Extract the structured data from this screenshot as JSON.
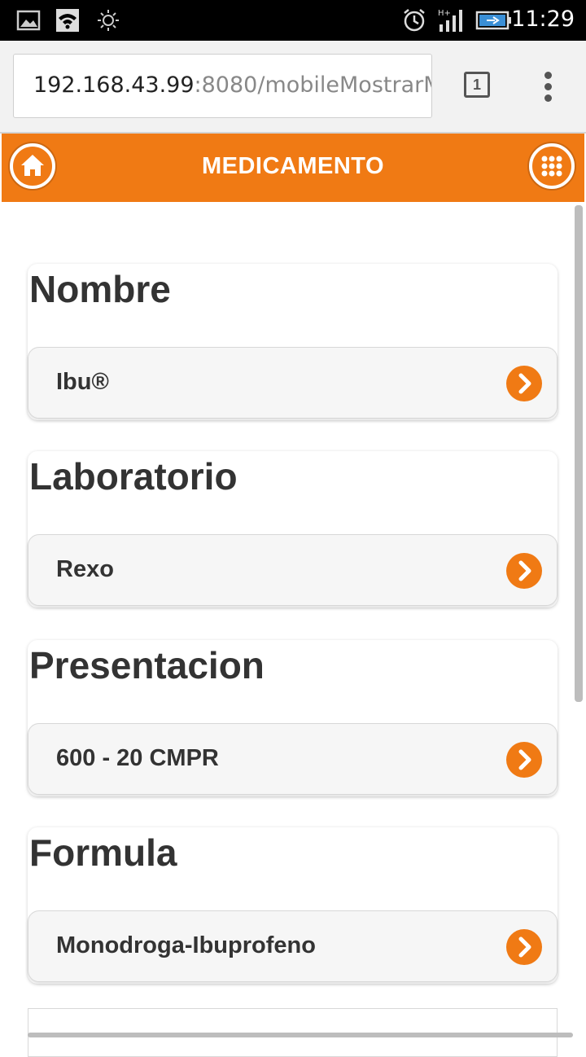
{
  "status_bar": {
    "time": "11:29",
    "icons": [
      "gallery-icon",
      "wifi-icon",
      "brightness-icon",
      "alarm-icon",
      "signal-icon",
      "battery-icon"
    ]
  },
  "browser": {
    "url_host": "192.168.43.99",
    "url_rest": ":8080/mobileMostrarM",
    "tab_count": "1"
  },
  "header": {
    "title": "MEDICAMENTO",
    "accent": "#f07a14"
  },
  "sections": [
    {
      "title": "Nombre",
      "value": "Ibu®"
    },
    {
      "title": "Laboratorio",
      "value": "Rexo"
    },
    {
      "title": "Presentacion",
      "value": "600 - 20 CMPR"
    },
    {
      "title": "Formula",
      "value": "Monodroga-Ibuprofeno"
    }
  ]
}
